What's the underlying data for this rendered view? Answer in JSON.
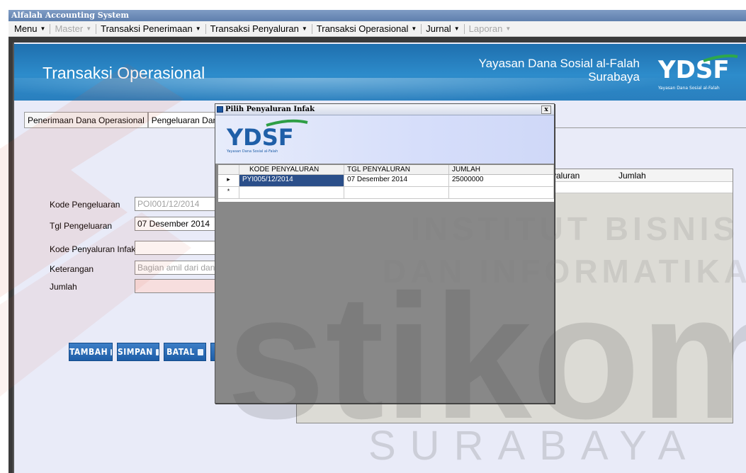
{
  "window": {
    "title": "Alfalah Accounting System"
  },
  "menubar": {
    "items": [
      {
        "label": "Menu",
        "enabled": true
      },
      {
        "label": "Master",
        "enabled": false
      },
      {
        "label": "Transaksi Penerimaan",
        "enabled": true
      },
      {
        "label": "Transaksi Penyaluran",
        "enabled": true
      },
      {
        "label": "Transaksi Operasional",
        "enabled": true
      },
      {
        "label": "Jurnal",
        "enabled": true
      },
      {
        "label": "Laporan",
        "enabled": false
      }
    ]
  },
  "banner": {
    "title": "Transaksi Operasional",
    "org_line1": "Yayasan Dana Sosial al-Falah",
    "org_line2": "Surabaya",
    "logo_text": "YDSF",
    "logo_caption": "Yayasan Dana Sosial al-Falah"
  },
  "tabs": [
    {
      "label": "Penerimaan Dana Operasional",
      "active": false
    },
    {
      "label": "Pengeluaran Dana Ope",
      "active": true
    }
  ],
  "form": {
    "kode_pengeluaran_label": "Kode Pengeluaran",
    "kode_pengeluaran_value": "POI001/12/2014",
    "tgl_pengeluaran_label": "Tgl Pengeluaran",
    "tgl_pengeluaran_value": "07 Desember 2014",
    "kode_penyaluran_label": "Kode Penyaluran Infak",
    "kode_penyaluran_value": "",
    "keterangan_label": "Keterangan",
    "keterangan_value": "Bagian amil dari dana i",
    "jumlah_label": "Jumlah",
    "jumlah_value": ""
  },
  "buttons": {
    "tambah": "TAMBAH",
    "simpan": "SIMPAN",
    "batal": "BATAL"
  },
  "background_grid": {
    "col1": "yaluran",
    "col2": "Jumlah"
  },
  "dialog": {
    "title": "Pilih Penyaluran Infak",
    "close": "x",
    "logo_text": "YDSF",
    "logo_caption": "Yayasan Dana Sosial al-Falah",
    "columns": [
      "KODE PENYALURAN",
      "TGL PENYALURAN",
      "JUMLAH"
    ],
    "rows": [
      {
        "indicator": "▸",
        "kode": "PYI005/12/2014",
        "tgl": "07 Desember 2014",
        "jumlah": "25000000"
      }
    ],
    "new_row_indicator": "*"
  },
  "watermark": {
    "line1": "INSTITUT BISNIS",
    "line2": "DAN INFORMATIKA",
    "brand": "stikom",
    "city": "SURABAYA"
  },
  "colors": {
    "banner": "#2d8ccb",
    "button": "#1e5ea8",
    "dialog_body": "#888888",
    "selection": "#2b4f8a",
    "logo_blue": "#1f5fa8",
    "logo_green": "#2e9e45"
  }
}
